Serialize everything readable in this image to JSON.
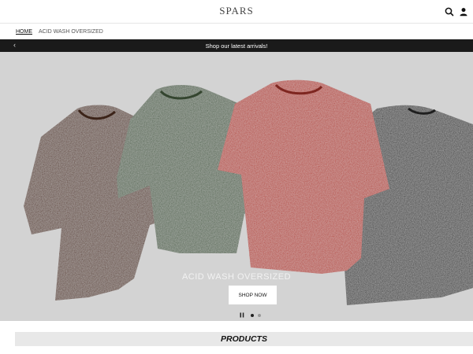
{
  "header": {
    "logo_text": "SPARS",
    "icons": [
      "search-icon",
      "user-icon"
    ]
  },
  "breadcrumb": {
    "home": "HOME",
    "current": "ACID WASH OVERSIZED"
  },
  "announcement": {
    "text": "Shop our latest arrivals!",
    "prev_icon": "chevron-left-icon"
  },
  "hero": {
    "title": "ACID WASH OVERSIZED",
    "cta_label": "SHOP NOW",
    "slide_count": 2,
    "active_slide": 1,
    "shirt_colors": [
      "#5b3b2c",
      "#4c6147",
      "#b33c33",
      "#3a3a3a"
    ],
    "background": "#d3d3d3"
  },
  "products": {
    "title": "PRODUCTS"
  }
}
